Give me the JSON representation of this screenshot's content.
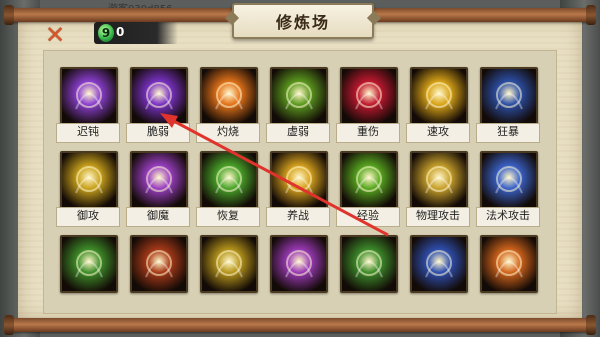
{
  "overlay_text": "游客030d856",
  "window": {
    "title": "修炼场"
  },
  "currency": {
    "icon": "green-gem-icon",
    "value": "0"
  },
  "colors": {
    "accent_orange": "#d5572a",
    "arrow_red": "#e0332b"
  },
  "skills": [
    {
      "label": "迟钝",
      "icon": "purple-claw-icon",
      "color": "#8b3fd1"
    },
    {
      "label": "脆弱",
      "icon": "purple-broken-spear-icon",
      "color": "#7a32c6"
    },
    {
      "label": "灼烧",
      "icon": "fire-flame-icon",
      "color": "#e3731a"
    },
    {
      "label": "虚弱",
      "icon": "green-demon-icon",
      "color": "#5c9a1f"
    },
    {
      "label": "重伤",
      "icon": "red-slash-icon",
      "color": "#c01830"
    },
    {
      "label": "速攻",
      "icon": "yellow-swirl-icon",
      "color": "#d9a418"
    },
    {
      "label": "狂暴",
      "icon": "blue-fist-icon",
      "color": "#2c4fa6"
    },
    {
      "label": "御攻",
      "icon": "gold-shield-icon",
      "color": "#c9a21c"
    },
    {
      "label": "御魔",
      "icon": "purple-shield-icon",
      "color": "#9a3fc2"
    },
    {
      "label": "恢复",
      "icon": "green-healing-icon",
      "color": "#4aa52a"
    },
    {
      "label": "养战",
      "icon": "golden-orb-icon",
      "color": "#d8a31f"
    },
    {
      "label": "经验",
      "icon": "green-sparkle-icon",
      "color": "#58a820"
    },
    {
      "label": "物理攻击",
      "icon": "golden-sword-icon",
      "color": "#c8a12c"
    },
    {
      "label": "法术攻击",
      "icon": "blue-lightning-icon",
      "color": "#3a62c9"
    },
    {
      "label": "",
      "icon": "green-orb-icon",
      "color": "#3f8f2a"
    },
    {
      "label": "",
      "icon": "red-flower-icon",
      "color": "#a83a18"
    },
    {
      "label": "",
      "icon": "gold-crown-icon",
      "color": "#b7961c"
    },
    {
      "label": "",
      "icon": "purple-swirl-icon",
      "color": "#9b3ab7"
    },
    {
      "label": "",
      "icon": "green-leaf-icon",
      "color": "#3d8d2b"
    },
    {
      "label": "",
      "icon": "blue-skull-icon",
      "color": "#2f4fb0"
    },
    {
      "label": "",
      "icon": "orange-fire-icon",
      "color": "#d2651c"
    }
  ]
}
